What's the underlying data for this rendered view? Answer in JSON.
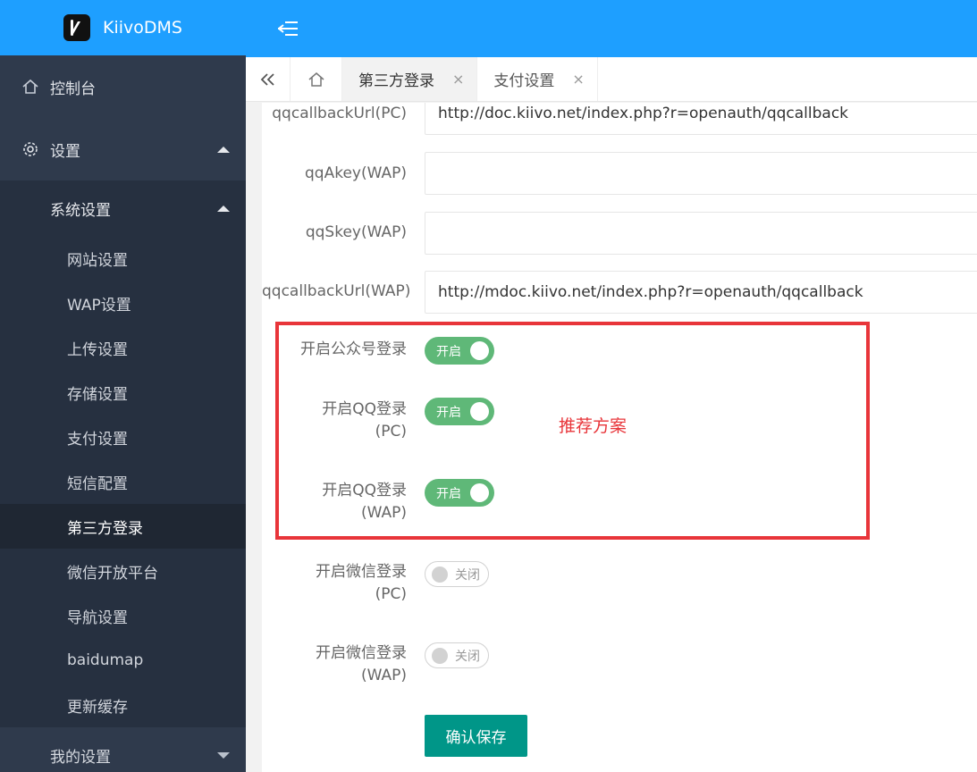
{
  "brand": {
    "name": "KiivoDMS",
    "color": "#1e9fff"
  },
  "sidebar": {
    "dashboard": {
      "label": "控制台",
      "icon": "home-icon"
    },
    "settings": {
      "label": "设置",
      "icon": "gear-icon"
    },
    "system": {
      "label": "系统设置",
      "items": [
        {
          "label": "网站设置"
        },
        {
          "label": "WAP设置"
        },
        {
          "label": "上传设置"
        },
        {
          "label": "存储设置"
        },
        {
          "label": "支付设置"
        },
        {
          "label": "短信配置"
        },
        {
          "label": "第三方登录",
          "active": true
        },
        {
          "label": "微信开放平台"
        },
        {
          "label": "导航设置"
        },
        {
          "label": "baidumap"
        },
        {
          "label": "更新缓存"
        }
      ]
    },
    "my_settings": {
      "label": "我的设置"
    }
  },
  "tabs": [
    {
      "label": "第三方登录",
      "active": true,
      "close": "×"
    },
    {
      "label": "支付设置",
      "active": false,
      "close": "×"
    }
  ],
  "form": {
    "qq_callback_pc": {
      "label": "qqcallbackUrl(PC)",
      "value": "http://doc.kiivo.net/index.php?r=openauth/qqcallback"
    },
    "qq_akey_wap": {
      "label": "qqAkey(WAP)",
      "value": ""
    },
    "qq_skey_wap": {
      "label": "qqSkey(WAP)",
      "value": ""
    },
    "qq_callback_wap": {
      "label": "qqcallbackUrl(WAP)",
      "value": "http://mdoc.kiivo.net/index.php?r=openauth/qqcallback"
    },
    "mp_login": {
      "label": "开启公众号登录",
      "state": "开启"
    },
    "qq_login_pc": {
      "label_1": "开启QQ登录",
      "label_2": "(PC)",
      "state": "开启"
    },
    "qq_login_wap": {
      "label_1": "开启QQ登录",
      "label_2": "(WAP)",
      "state": "开启"
    },
    "wx_login_pc": {
      "label_1": "开启微信登录",
      "label_2": "(PC)",
      "state": "关闭"
    },
    "wx_login_wap": {
      "label_1": "开启微信登录",
      "label_2": "(WAP)",
      "state": "关闭"
    },
    "save_label": "确认保存"
  },
  "annotation": {
    "text": "推荐方案",
    "color": "#e8353a"
  }
}
